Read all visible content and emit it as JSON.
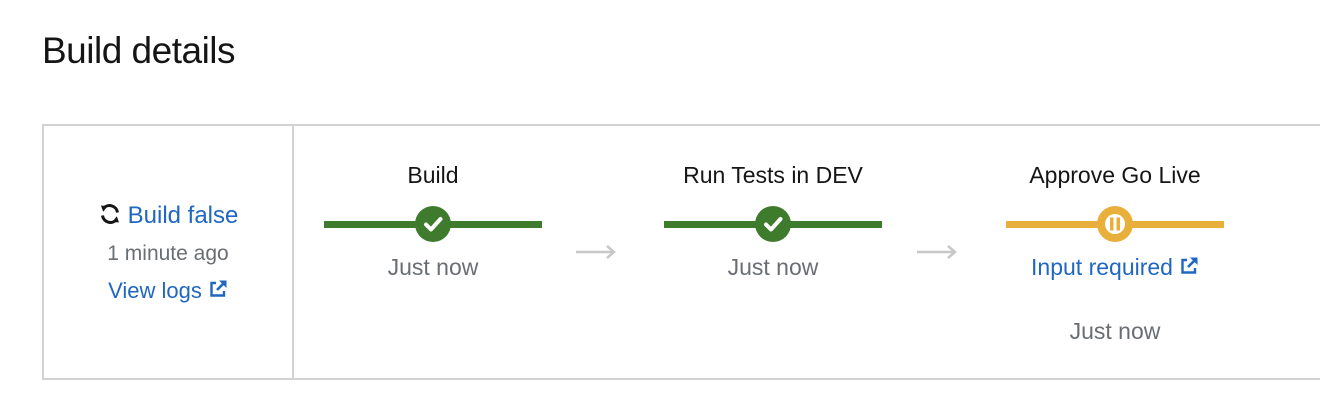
{
  "page": {
    "title": "Build details"
  },
  "build": {
    "link_label": "Build false",
    "time_ago": "1 minute ago",
    "view_logs_label": "View logs",
    "icon": "sync-icon"
  },
  "stages": [
    {
      "name": "Build",
      "status": "success",
      "time": "Just now"
    },
    {
      "name": "Run Tests in DEV",
      "status": "success",
      "time": "Just now"
    },
    {
      "name": "Approve Go Live",
      "status": "paused",
      "input_label": "Input required",
      "time": "Just now"
    }
  ],
  "colors": {
    "success": "#3e7b2c",
    "paused": "#e8b03a",
    "link": "#1f67c0",
    "muted": "#6a6e73",
    "border": "#d2d2d2",
    "arrow": "#c7c7c7"
  }
}
